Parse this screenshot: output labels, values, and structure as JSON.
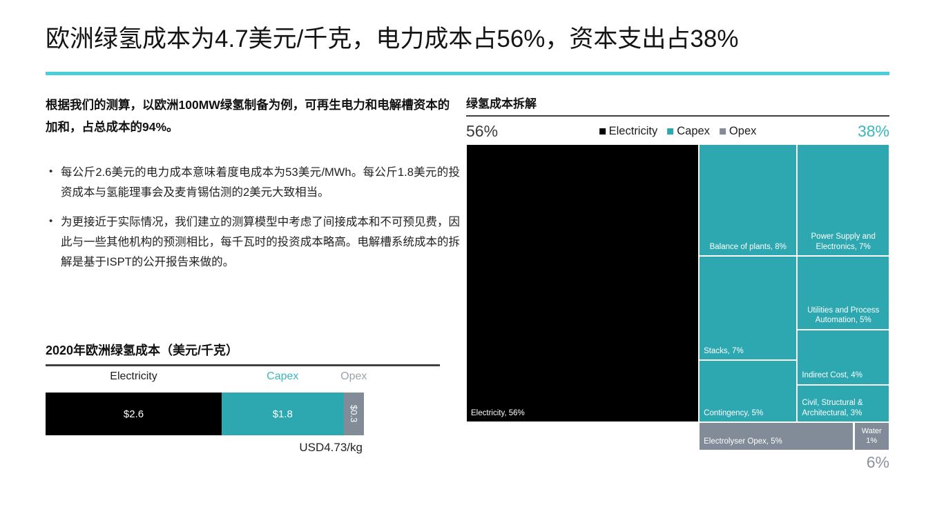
{
  "title": "欧洲绿氢成本为4.7美元/千克，电力成本占56%，资本支出占38%",
  "accent_rule_color": "#4ACEDE",
  "colors": {
    "electricity": "#000000",
    "capex": "#2EA8B0",
    "opex": "#828C99",
    "accent": "#4ACEDE",
    "capex_text": "#3AB6BE",
    "opex_text": "#9AA3AC"
  },
  "left": {
    "lead_paragraph": "根据我们的测算，以欧洲100MW绿氢制备为例，可再生电力和电解槽资本的加和，占总成本的94%。",
    "bullet_marker": "•",
    "bullets": [
      "每公斤2.6美元的电力成本意味着度电成本为53美元/MWh。每公斤1.8美元的投资成本与氢能理事会及麦肯锡估测的2美元大致相当。",
      "为更接近于实际情况，我们建立的测算模型中考虑了间接成本和不可预见费，因此与一些其他机构的预测相比，每千瓦时的投资成本略高。电解槽系统成本的拆解是基于ISPT的公开报告来做的。"
    ]
  },
  "chart_left": {
    "title": "2020年欧洲绿氢成本（美元/千克）",
    "total_label": "USD4.73/kg"
  },
  "treemap_panel": {
    "title": "绿氢成本拆解",
    "pct_left": "56%",
    "pct_right": "38%",
    "pct_bottom": "6%",
    "legend": [
      {
        "label": "Electricity",
        "color": "#000000"
      },
      {
        "label": "Capex",
        "color": "#2EA8B0"
      },
      {
        "label": "Opex",
        "color": "#828C99"
      }
    ]
  },
  "chart_data": [
    {
      "type": "bar",
      "orientation": "horizontal-stacked",
      "title": "2020年欧洲绿氢成本（美元/千克）",
      "xlabel": "",
      "ylabel": "USD/kg",
      "unit": "USD/kg",
      "total": 4.73,
      "total_label": "USD4.73/kg",
      "categories": [
        "Electricity",
        "Capex",
        "Opex"
      ],
      "values": [
        2.6,
        1.8,
        0.3
      ],
      "value_labels": [
        "$2.6",
        "$1.8",
        "$0.3"
      ],
      "colors": [
        "#000000",
        "#2EA8B0",
        "#828C99"
      ],
      "header_labels": [
        "Electricity",
        "Capex",
        "Opex"
      ],
      "header_colors": [
        "#1c1c1c",
        "#3AB6BE",
        "#9AA3AC"
      ],
      "legend": "inline-above-bar",
      "grid": false
    },
    {
      "type": "treemap",
      "title": "绿氢成本拆解",
      "unit": "percent of total cost",
      "legend": [
        "Electricity",
        "Capex",
        "Opex"
      ],
      "group_totals": {
        "Electricity": 56,
        "Capex": 38,
        "Opex": 6
      },
      "group_total_labels": {
        "Electricity": "56%",
        "Capex": "38%",
        "Opex": "6%"
      },
      "nodes": [
        {
          "label": "Electricity, 56%",
          "name": "Electricity",
          "value": 56,
          "group": "Electricity",
          "color": "#000000",
          "align": "left"
        },
        {
          "label": "Balance of plants, 8%",
          "name": "Balance of plants",
          "value": 8,
          "group": "Capex",
          "color": "#2EA8B0",
          "align": "center"
        },
        {
          "label": "Power Supply and Electronics, 7%",
          "name": "Power Supply and Electronics",
          "value": 7,
          "group": "Capex",
          "color": "#2EA8B0",
          "align": "center"
        },
        {
          "label": "Stacks, 7%",
          "name": "Stacks",
          "value": 7,
          "group": "Capex",
          "color": "#2EA8B0",
          "align": "left"
        },
        {
          "label": "Utilities and Process Automation, 5%",
          "name": "Utilities and Process Automation",
          "value": 5,
          "group": "Capex",
          "color": "#2EA8B0",
          "align": "center"
        },
        {
          "label": "Indirect Cost, 4%",
          "name": "Indirect Cost",
          "value": 4,
          "group": "Capex",
          "color": "#2EA8B0",
          "align": "left"
        },
        {
          "label": "Contingency, 5%",
          "name": "Contingency",
          "value": 5,
          "group": "Capex",
          "color": "#2EA8B0",
          "align": "left"
        },
        {
          "label": "Civil, Structural & Architectural, 3%",
          "name": "Civil, Structural & Architectural",
          "value": 3,
          "group": "Capex",
          "color": "#2EA8B0",
          "align": "left"
        },
        {
          "label": "Electrolyser Opex, 5%",
          "name": "Electrolyser Opex",
          "value": 5,
          "group": "Opex",
          "color": "#828C99",
          "align": "left"
        },
        {
          "label": "Water 1%",
          "name": "Water",
          "value": 1,
          "group": "Opex",
          "color": "#828C99",
          "align": "center"
        }
      ]
    }
  ]
}
